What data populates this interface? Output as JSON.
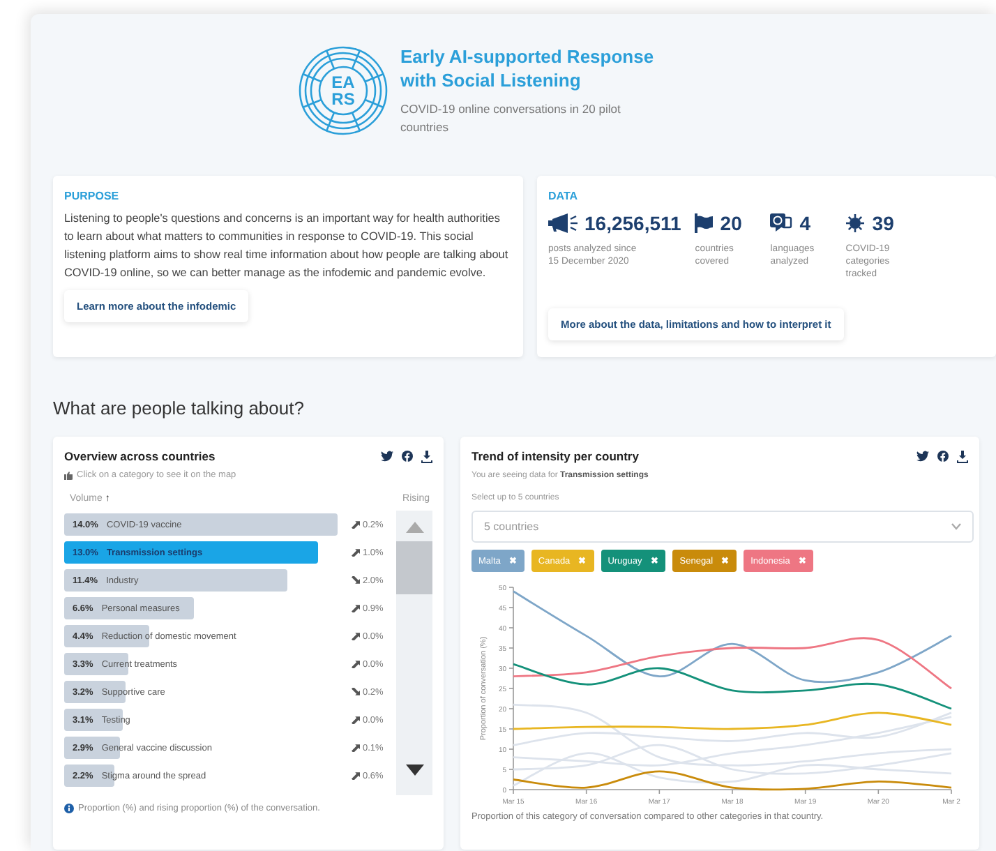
{
  "header": {
    "logo_lines": [
      "EA",
      "RS"
    ],
    "title_lines": [
      "Early AI-supported Response",
      "with Social Listening"
    ],
    "subtitle": "COVID-19 online conversations in 20 pilot countries"
  },
  "purpose": {
    "title": "PURPOSE",
    "text": "Listening to people's questions and concerns is an important way for health authorities to learn about what matters to communities in response to COVID-19. This social listening platform aims to show real time information about how people are talking about COVID-19 online, so we can better manage as the infodemic and pandemic evolve.",
    "link": "Learn more about the infodemic"
  },
  "data": {
    "title": "DATA",
    "link": "More about the data, limitations and how to interpret it",
    "stats": [
      {
        "kind": "megaphone",
        "value": "16,256,511",
        "caption": "posts analyzed since 15 December 2020"
      },
      {
        "kind": "flag",
        "value": "20",
        "caption": "countries covered"
      },
      {
        "kind": "languages",
        "value": "4",
        "caption": "languages analyzed"
      },
      {
        "kind": "virus",
        "value": "39",
        "caption": "COVID-19 categories tracked"
      }
    ]
  },
  "section_heading": "What are people talking about?",
  "overview": {
    "title": "Overview across countries",
    "hint": "Click on a category to see it on the map",
    "volume_header": "Volume",
    "sort_arrow": "↑",
    "rising_header": "Rising",
    "footer": "Proportion (%) and rising proportion (%) of the conversation.",
    "rows": [
      {
        "pct": "14.0%",
        "label": "COVID-19 vaccine",
        "level": 0.97,
        "rising_up": true,
        "rising": "0.2%",
        "selected": false
      },
      {
        "pct": "13.0%",
        "label": "Transmission settings",
        "level": 0.9,
        "rising_up": true,
        "rising": "1.0%",
        "selected": true
      },
      {
        "pct": "11.4%",
        "label": "Industry",
        "level": 0.79,
        "rising_up": false,
        "rising": "2.0%",
        "selected": false
      },
      {
        "pct": "6.6%",
        "label": "Personal measures",
        "level": 0.46,
        "rising_up": true,
        "rising": "0.9%",
        "selected": false
      },
      {
        "pct": "4.4%",
        "label": "Reduction of domestic movement",
        "level": 0.3,
        "rising_up": true,
        "rising": "0.0%",
        "selected": false
      },
      {
        "pct": "3.3%",
        "label": "Current treatments",
        "level": 0.23,
        "rising_up": true,
        "rising": "0.0%",
        "selected": false
      },
      {
        "pct": "3.2%",
        "label": "Supportive care",
        "level": 0.22,
        "rising_up": false,
        "rising": "0.2%",
        "selected": false
      },
      {
        "pct": "3.1%",
        "label": "Testing",
        "level": 0.21,
        "rising_up": true,
        "rising": "0.0%",
        "selected": false
      },
      {
        "pct": "2.9%",
        "label": "General vaccine discussion",
        "level": 0.2,
        "rising_up": true,
        "rising": "0.1%",
        "selected": false
      },
      {
        "pct": "2.2%",
        "label": "Stigma around the spread",
        "level": 0.18,
        "rising_up": true,
        "rising": "0.6%",
        "selected": false
      }
    ]
  },
  "trend": {
    "title": "Trend of intensity per country",
    "seeing_prefix": "You are seeing data for",
    "seeing_category": "Transmission settings",
    "select_label": "Select up to 5 countries",
    "select_value": "5 countries",
    "remove_glyph": "✖",
    "caption": "Proportion of this category of conversation compared to other categories in that country.",
    "countries": [
      {
        "name": "Malta",
        "color": "#7ea6c8"
      },
      {
        "name": "Canada",
        "color": "#e8b622"
      },
      {
        "name": "Uruguay",
        "color": "#14917a"
      },
      {
        "name": "Senegal",
        "color": "#c98b0b"
      },
      {
        "name": "Indonesia",
        "color": "#ee7683"
      }
    ],
    "chart_data": {
      "type": "line",
      "ylabel": "Proportion of conversation (%)",
      "categories": [
        "Mar 15",
        "Mar 16",
        "Mar 17",
        "Mar 18",
        "Mar 19",
        "Mar 20",
        "Mar 2"
      ],
      "ylim": [
        0,
        50
      ],
      "yticks": [
        0,
        5,
        10,
        15,
        20,
        25,
        30,
        35,
        40,
        45,
        50
      ],
      "series": [
        {
          "color": "#dde3ec",
          "values": [
            21,
            19,
            8,
            6,
            7,
            9,
            10
          ]
        },
        {
          "color": "#dde3ec",
          "values": [
            11,
            14,
            13,
            12,
            14,
            13,
            19
          ]
        },
        {
          "color": "#dde3ec",
          "values": [
            8,
            7,
            6,
            9,
            11,
            14,
            18
          ]
        },
        {
          "color": "#dde3ec",
          "values": [
            5,
            6,
            11,
            5,
            4,
            6,
            9
          ]
        },
        {
          "color": "#dde3ec",
          "values": [
            1,
            9,
            3,
            2,
            6,
            5,
            4
          ]
        },
        {
          "color": "#7ea6c8",
          "values": [
            49,
            38,
            28,
            36,
            27,
            29,
            38
          ]
        },
        {
          "color": "#ee7683",
          "values": [
            28,
            29,
            33,
            35,
            35,
            37,
            25
          ]
        },
        {
          "color": "#14917a",
          "values": [
            31,
            26,
            30,
            24.5,
            24.5,
            26,
            20
          ]
        },
        {
          "color": "#e8b622",
          "values": [
            15,
            15.5,
            15.5,
            15,
            16,
            19,
            16
          ]
        },
        {
          "color": "#c98b0b",
          "values": [
            2.5,
            0.5,
            4.5,
            0.5,
            0.2,
            2,
            0.5
          ]
        }
      ]
    }
  }
}
